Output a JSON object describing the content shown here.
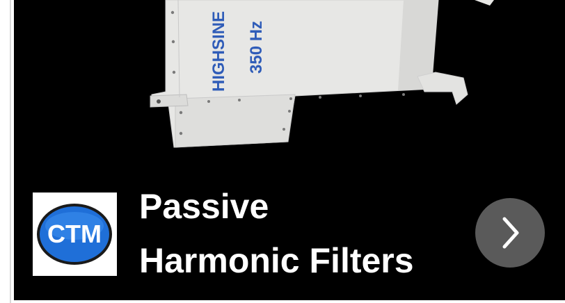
{
  "card": {
    "product_label_line1": "HIGHSINE",
    "product_label_line2": "350 Hz",
    "title_line1": "Passive",
    "title_line2": "Harmonic Filters",
    "logo_text": "CTM",
    "next_icon": "chevron-right-icon"
  },
  "colors": {
    "card_background": "#000000",
    "title_text": "#ffffff",
    "button_background": "#5a5a5a",
    "logo_blue": "#1f6fd8",
    "label_blue": "#2f5cb8"
  }
}
